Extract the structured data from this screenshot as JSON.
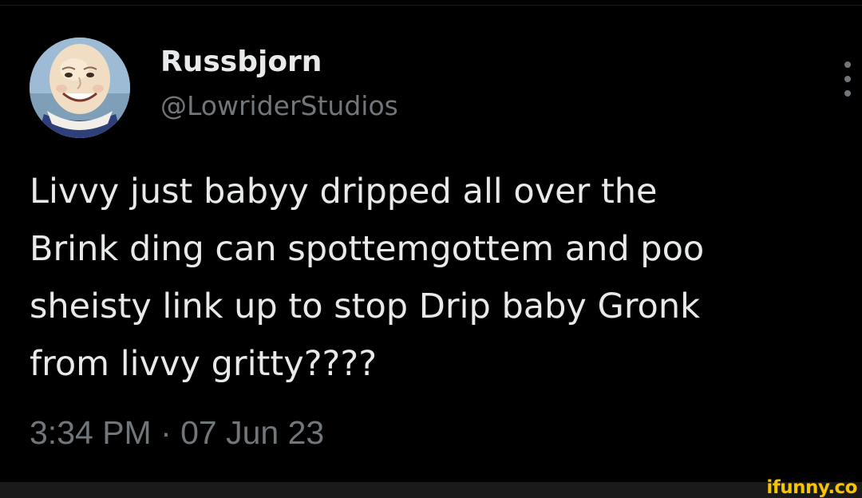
{
  "author": {
    "display_name": "Russbjorn",
    "handle": "@LowriderStudios"
  },
  "tweet": {
    "lines": [
      "Livvy just babyy dripped all over the",
      "Brink ding can spottemgottem and poo",
      "sheisty link up to stop Drip baby Gronk",
      "from livvy gritty????"
    ],
    "timestamp": "3:34 PM · 07 Jun 23"
  },
  "icons": {
    "more": "more-options-icon",
    "avatar": "humpty-dumpty-avatar"
  },
  "watermark": "ifunny.co",
  "colors": {
    "background": "#000000",
    "primary_text": "#e7e9ea",
    "secondary_text": "#71767b",
    "watermark": "#f7c500"
  }
}
